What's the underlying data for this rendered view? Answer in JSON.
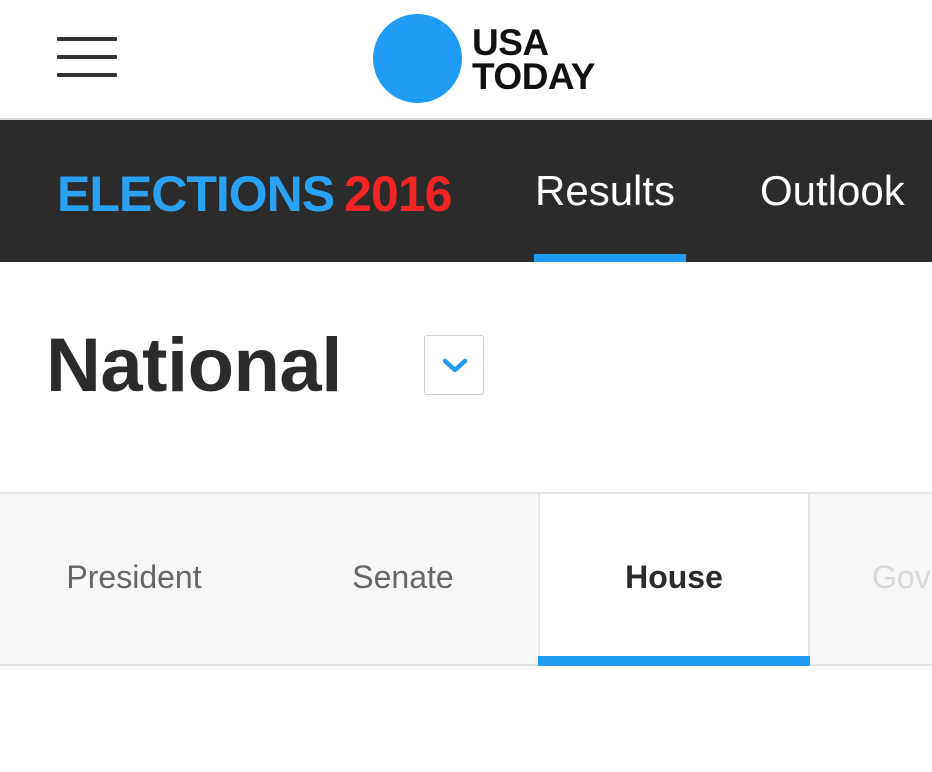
{
  "header": {
    "menu_icon": "hamburger-menu-icon",
    "logo": {
      "line1": "USA",
      "line2": "TODAY",
      "dot_color": "#1f9cf5"
    }
  },
  "elections_nav": {
    "brand_word": "ELECTIONS",
    "brand_year": "2016",
    "brand_word_color": "#2aa1f3",
    "brand_year_color": "#f22424",
    "tabs": [
      {
        "label": "Results",
        "active": true
      },
      {
        "label": "Outlook",
        "active": false
      }
    ],
    "active_color": "#1f9cf5"
  },
  "section": {
    "title": "National",
    "dropdown_icon": "chevron-down-icon"
  },
  "race_tabs": {
    "tabs": [
      {
        "label": "President",
        "active": false
      },
      {
        "label": "Senate",
        "active": false
      },
      {
        "label": "House",
        "active": true
      },
      {
        "label": "Gov",
        "active": false
      }
    ],
    "active_color": "#1f9cf5"
  }
}
